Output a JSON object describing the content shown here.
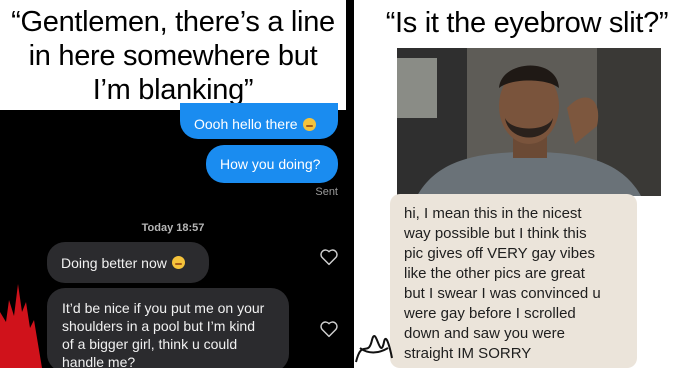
{
  "left_panel": {
    "caption_lines": [
      "“Gentlemen, there’s a line",
      "in here somewhere but",
      "I’m blanking”"
    ],
    "outgoing": [
      {
        "text": "Oooh hello there",
        "emoji": "smirk-emoji"
      },
      {
        "text": "How you doing?"
      }
    ],
    "sent_label": "Sent",
    "timestamp": "Today 18:57",
    "incoming": [
      {
        "text": "Doing better now",
        "emoji": "smirk-emoji"
      },
      {
        "lines": [
          "It’d be nice if you put me on your",
          "shoulders in a pool but I’m kind",
          "of a bigger girl, think u could",
          "handle me?"
        ]
      }
    ],
    "colors": {
      "outgoing_bubble": "#1a8cf0",
      "incoming_bubble": "#2b2b2e",
      "background": "#000000"
    }
  },
  "right_panel": {
    "caption": "“Is it the eyebrow slit?”",
    "message_lines": [
      "hi, I mean this in the nicest",
      "way possible but I think this",
      "pic gives off VERY gay vibes",
      "like the other pics are great",
      "but I swear I was convinced u",
      "were gay before I scrolled",
      "down and saw you were",
      "straight IM SORRY"
    ],
    "colors": {
      "message_card": "#ebe4da"
    }
  }
}
